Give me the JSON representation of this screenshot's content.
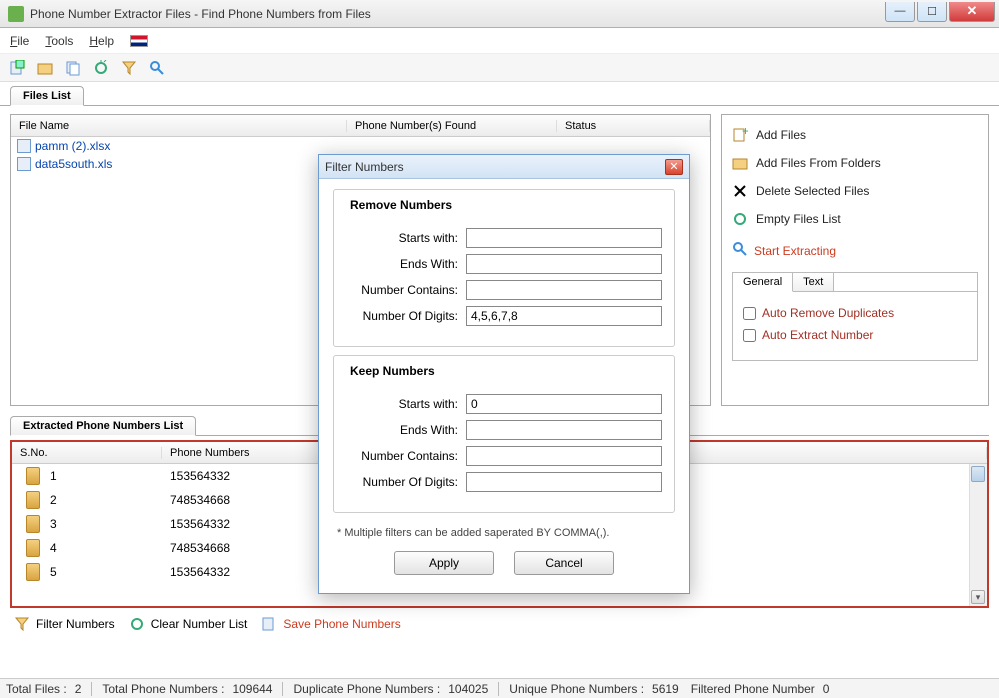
{
  "window": {
    "title": "Phone Number Extractor Files - Find Phone Numbers from Files"
  },
  "menu": {
    "file": "File",
    "tools": "Tools",
    "help": "Help"
  },
  "tabs": {
    "files_list": "Files List"
  },
  "files_table": {
    "headers": {
      "filename": "File Name",
      "found": "Phone Number(s) Found",
      "status": "Status"
    },
    "rows": [
      {
        "name": "pamm (2).xlsx"
      },
      {
        "name": "data5south.xls"
      }
    ]
  },
  "side": {
    "add_files": "Add Files",
    "add_folders": "Add Files From Folders",
    "delete_selected": "Delete Selected Files",
    "empty_list": "Empty Files List",
    "start": "Start Extracting",
    "subtabs": {
      "general": "General",
      "text": "Text"
    },
    "opts": {
      "auto_remove_dup": "Auto Remove Duplicates",
      "auto_extract": "Auto Extract Number"
    }
  },
  "extracted": {
    "tab": "Extracted Phone Numbers List",
    "headers": {
      "sno": "S.No.",
      "phone": "Phone Numbers"
    },
    "rows": [
      {
        "sno": "1",
        "phone": "153564332"
      },
      {
        "sno": "2",
        "phone": "748534668"
      },
      {
        "sno": "3",
        "phone": "153564332"
      },
      {
        "sno": "4",
        "phone": "748534668"
      },
      {
        "sno": "5",
        "phone": "153564332"
      }
    ]
  },
  "bottom": {
    "filter": "Filter Numbers",
    "clear": "Clear Number List",
    "save": "Save Phone Numbers"
  },
  "status": {
    "total_files_label": "Total Files :",
    "total_files": "2",
    "total_phone_label": "Total Phone Numbers :",
    "total_phone": "109644",
    "dup_label": "Duplicate Phone Numbers :",
    "dup": "104025",
    "unique_label": "Unique Phone Numbers :",
    "unique": "5619",
    "filtered_label": "Filtered Phone Number",
    "filtered": "0"
  },
  "modal": {
    "title": "Filter Numbers",
    "remove_title": "Remove Numbers",
    "keep_title": "Keep Numbers",
    "labels": {
      "starts": "Starts with:",
      "ends": "Ends With:",
      "contains": "Number Contains:",
      "digits": "Number Of Digits:"
    },
    "remove": {
      "starts": "",
      "ends": "",
      "contains": "",
      "digits": "4,5,6,7,8"
    },
    "keep": {
      "starts": "0",
      "ends": "",
      "contains": "",
      "digits": ""
    },
    "note": "* Multiple filters can be added saperated BY COMMA(,).",
    "apply": "Apply",
    "cancel": "Cancel"
  }
}
